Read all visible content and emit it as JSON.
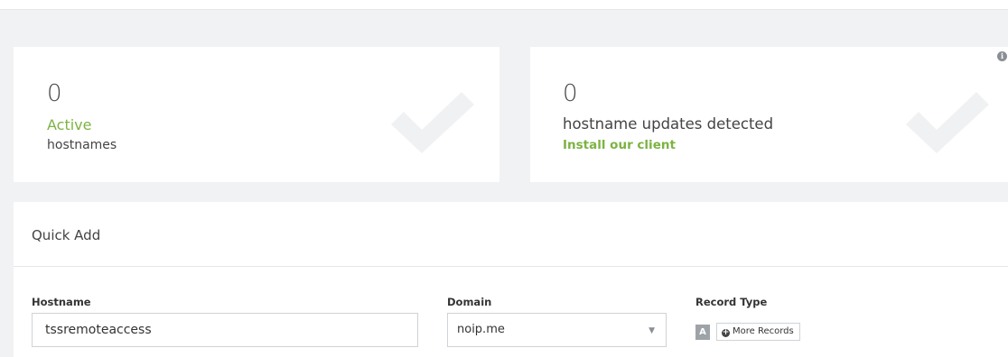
{
  "stats": {
    "active": {
      "count": "0",
      "label": "Active",
      "sublabel": "hostnames",
      "icon": "check-icon"
    },
    "updates": {
      "count": "0",
      "label": "hostname updates detected",
      "link": "Install our client",
      "icon": "check-icon"
    }
  },
  "info_icon": "info-icon",
  "quick_add": {
    "title": "Quick Add",
    "hostname": {
      "label": "Hostname",
      "value": "tssremoteaccess"
    },
    "domain": {
      "label": "Domain",
      "value": "noip.me",
      "caret": "▼"
    },
    "record_type": {
      "label": "Record Type",
      "selected": "A",
      "more_label": "More Records",
      "more_icon": "plus-circle-icon"
    }
  },
  "colors": {
    "accent_green": "#7cb342",
    "background": "#f1f2f4",
    "card": "#ffffff",
    "checkmark": "#f0f1f3"
  }
}
